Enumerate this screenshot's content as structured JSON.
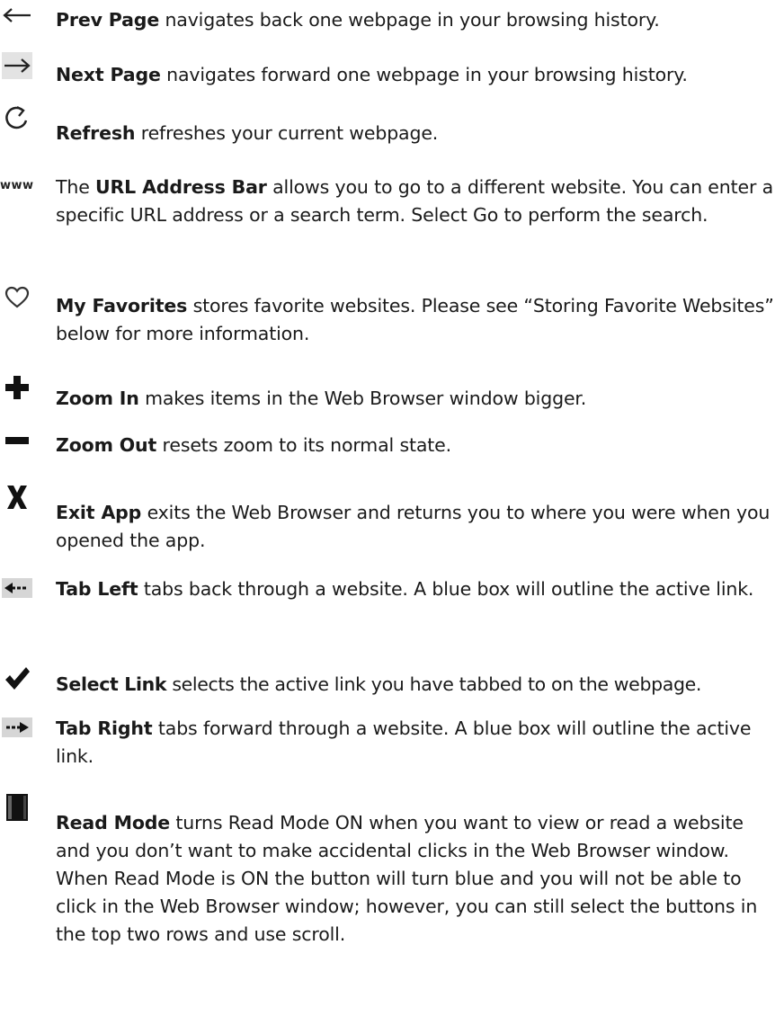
{
  "entries": [
    {
      "icon": "back-arrow-icon",
      "term": "Prev Page",
      "desc": " navigates back one webpage in your browsing history."
    },
    {
      "icon": "forward-arrow-icon",
      "term": "Next Page",
      "desc": " navigates forward one webpage in your browsing history."
    },
    {
      "icon": "refresh-icon",
      "term": "Refresh",
      "desc": " refreshes your current webpage."
    },
    {
      "icon": "www-icon",
      "icon_text": "www",
      "prefix": "The ",
      "term": "URL Address Bar",
      "desc": " allows you to go to a different website. You can enter a specific URL address or a search term. Select Go to perform the search."
    },
    {
      "icon": "heart-icon",
      "term": "My Favorites",
      "desc": " stores favorite websites. Please see “Storing Favorite Websites” below for more information."
    },
    {
      "icon": "plus-icon",
      "term": "Zoom In",
      "desc": " makes items in the Web Browser window bigger."
    },
    {
      "icon": "minus-icon",
      "term": "Zoom Out",
      "desc": " resets zoom to its normal state."
    },
    {
      "icon": "x-close-icon",
      "term": "Exit App",
      "desc": " exits the Web Browser and returns you to where you were when you opened the app."
    },
    {
      "icon": "tab-left-icon",
      "term": "Tab Left",
      "desc": " tabs back through a website. A blue box will outline the active link."
    },
    {
      "icon": "checkmark-icon",
      "term": "Select Link",
      "desc": " selects the active link you have tabbed to on the webpage."
    },
    {
      "icon": "tab-right-icon",
      "term": "Tab Right",
      "desc": " tabs forward through a website. A blue box will outline the active link."
    },
    {
      "icon": "read-mode-icon",
      "term": "Read Mode",
      "desc": " turns Read Mode ON when you want to view or read a website and you don’t want to make accidental clicks in the Web Browser window. When Read Mode is ON the button will turn blue and you will not be able to click in the Web Browser window; however, you can still select the buttons in the top two rows and use scroll."
    }
  ]
}
